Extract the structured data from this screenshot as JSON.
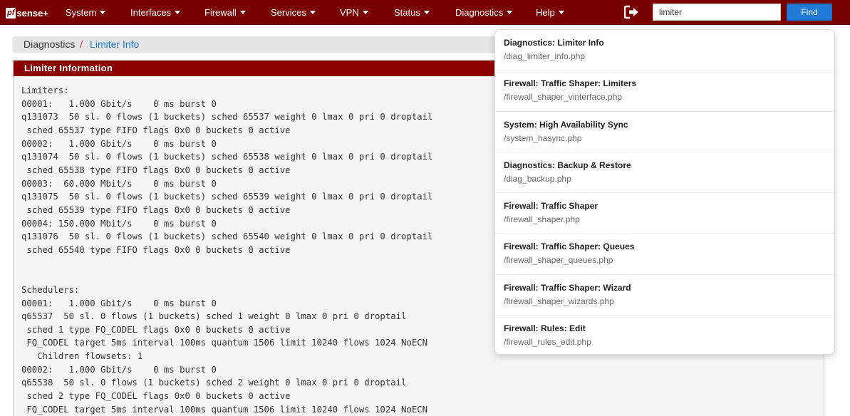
{
  "navbar": {
    "logo_pf": "pf",
    "logo_sense": "sense",
    "logo_plus": "+",
    "items": [
      {
        "label": "System"
      },
      {
        "label": "Interfaces"
      },
      {
        "label": "Firewall"
      },
      {
        "label": "Services"
      },
      {
        "label": "VPN"
      },
      {
        "label": "Status"
      },
      {
        "label": "Diagnostics"
      },
      {
        "label": "Help"
      }
    ],
    "search_value": "limiter",
    "find_label": "Find",
    "logout_icon": "sign-out-icon"
  },
  "breadcrumb": {
    "parent": "Diagnostics",
    "separator": "/",
    "current": "Limiter Info"
  },
  "panel": {
    "heading": "Limiter Information",
    "output": "Limiters:\n00001:   1.000 Gbit/s    0 ms burst 0\nq131073  50 sl. 0 flows (1 buckets) sched 65537 weight 0 lmax 0 pri 0 droptail\n sched 65537 type FIFO flags 0x0 0 buckets 0 active\n00002:   1.000 Gbit/s    0 ms burst 0\nq131074  50 sl. 0 flows (1 buckets) sched 65538 weight 0 lmax 0 pri 0 droptail\n sched 65538 type FIFO flags 0x0 0 buckets 0 active\n00003:  60.000 Mbit/s    0 ms burst 0\nq131075  50 sl. 0 flows (1 buckets) sched 65539 weight 0 lmax 0 pri 0 droptail\n sched 65539 type FIFO flags 0x0 0 buckets 0 active\n00004: 150.000 Mbit/s    0 ms burst 0\nq131076  50 sl. 0 flows (1 buckets) sched 65540 weight 0 lmax 0 pri 0 droptail\n sched 65540 type FIFO flags 0x0 0 buckets 0 active\n\n\nSchedulers:\n00001:   1.000 Gbit/s    0 ms burst 0\nq65537  50 sl. 0 flows (1 buckets) sched 1 weight 0 lmax 0 pri 0 droptail\n sched 1 type FQ_CODEL flags 0x0 0 buckets 0 active\n FQ_CODEL target 5ms interval 100ms quantum 1506 limit 10240 flows 1024 NoECN\n   Children flowsets: 1\n00002:   1.000 Gbit/s    0 ms burst 0\nq65538  50 sl. 0 flows (1 buckets) sched 2 weight 0 lmax 0 pri 0 droptail\n sched 2 type FQ_CODEL flags 0x0 0 buckets 0 active\n FQ_CODEL target 5ms interval 100ms quantum 1506 limit 10240 flows 1024 NoECN"
  },
  "search_results": [
    {
      "title": "Diagnostics: Limiter Info",
      "path": "/diag_limiter_info.php"
    },
    {
      "title": "Firewall: Traffic Shaper: Limiters",
      "path": "/firewall_shaper_vinterface.php"
    },
    {
      "title": "System: High Availability Sync",
      "path": "/system_hasync.php"
    },
    {
      "title": "Diagnostics: Backup & Restore",
      "path": "/diag_backup.php"
    },
    {
      "title": "Firewall: Traffic Shaper",
      "path": "/firewall_shaper.php"
    },
    {
      "title": "Firewall: Traffic Shaper: Queues",
      "path": "/firewall_shaper_queues.php"
    },
    {
      "title": "Firewall: Traffic Shaper: Wizard",
      "path": "/firewall_shaper_wizards.php"
    },
    {
      "title": "Firewall: Rules: Edit",
      "path": "/firewall_rules_edit.php"
    }
  ],
  "colors": {
    "navbar_bg": "#7a0000",
    "panel_heading_bg": "#8b0000",
    "accent_blue": "#1f7bd6"
  }
}
